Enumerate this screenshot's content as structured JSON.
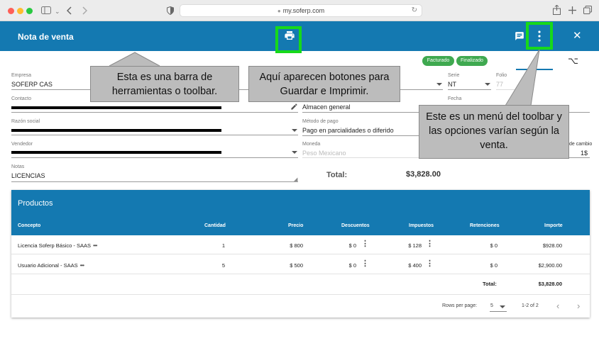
{
  "browser": {
    "url": "my.soferp.com"
  },
  "toolbar": {
    "title": "Nota de venta",
    "close_glyph": "✕"
  },
  "status": {
    "chip1": "Facturado",
    "chip2": "Finalizado"
  },
  "form": {
    "empresa_label": "Empresa",
    "empresa_value": "SOFERP CAS",
    "serie_label": "Serie",
    "serie_value": "NT",
    "folio_label": "Folio",
    "folio_value": "77",
    "contacto_label": "Contacto",
    "fecha_label": "Fecha",
    "almacen_value": "Almacen general",
    "razon_label": "Razón social",
    "metodo_label": "Método de pago",
    "metodo_value": "Pago en parcialidades o diferido",
    "vendedor_label": "Vendedor",
    "moneda_label": "Moneda",
    "moneda_value": "Peso Mexicano",
    "tipo_cambio_label": "de cambio",
    "tipo_cambio_value": "1$",
    "notas_label": "Notas",
    "notas_value": "LICENCIAS",
    "total_label": "Total:",
    "total_value": "$3,828.00"
  },
  "products": {
    "title": "Productos",
    "headers": [
      "Concepto",
      "Cantidad",
      "Precio",
      "Descuentos",
      "Impuestos",
      "Retenciones",
      "Importe"
    ],
    "rows": [
      {
        "concepto": "Licencia Soferp Básico - SAAS",
        "cantidad": "1",
        "precio": "$ 800",
        "descuentos": "$ 0",
        "impuestos": "$ 128",
        "retenciones": "$ 0",
        "importe": "$928.00"
      },
      {
        "concepto": "Usuario Adicional - SAAS",
        "cantidad": "5",
        "precio": "$ 500",
        "descuentos": "$ 0",
        "impuestos": "$ 400",
        "retenciones": "$ 0",
        "importe": "$2,900.00"
      }
    ],
    "total_label": "Total:",
    "total_value": "$3,828.00",
    "rows_per_page_label": "Rows per page:",
    "rows_per_page_value": "5",
    "range": "1-2 of 2"
  },
  "annotations": {
    "toolbar_note": "Esta es una barra de herramientas o toolbar.",
    "buttons_note": "Aquí aparecen botones para Guardar e Imprimir.",
    "menu_note": "Este es un menú del toolbar y las opciones varían según la venta."
  },
  "colors": {
    "toolbar": "#1479b1",
    "chip": "#3fa950",
    "highlight": "#17d91a",
    "callout": "#bcbcbc"
  },
  "icons": [
    "sidebar-icon",
    "back-icon",
    "forward-icon",
    "shield-icon",
    "lock-icon",
    "reload-icon",
    "share-icon",
    "plus-icon",
    "tabs-icon",
    "print-icon",
    "notes-icon",
    "kebab-menu-icon",
    "close-icon",
    "option-key-icon",
    "edit-icon"
  ]
}
